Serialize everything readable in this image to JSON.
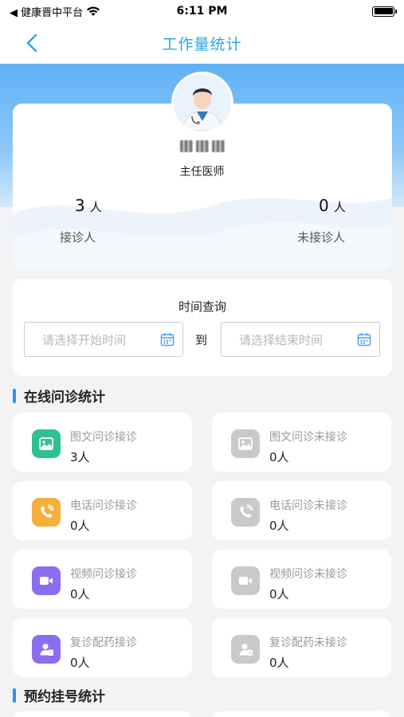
{
  "status_bar": {
    "carrier": "◀ 健康晋中平台",
    "time": "6:11 PM"
  },
  "nav": {
    "title": "工作量统计"
  },
  "profile": {
    "doctor_title": "主任医师",
    "received_count": "3",
    "received_unit": "人",
    "received_label": "接诊人",
    "not_received_count": "0",
    "not_received_unit": "人",
    "not_received_label": "未接诊人"
  },
  "query": {
    "title": "时间查询",
    "start_placeholder": "请选择开始时间",
    "end_placeholder": "请选择结束时间",
    "to_label": "到"
  },
  "sections": {
    "online": "在线问诊统计",
    "appointment": "预约挂号统计"
  },
  "tiles": [
    {
      "label": "图文问诊接诊",
      "value": "3人",
      "icon": "image-icon",
      "color": "#2ec28f"
    },
    {
      "label": "图文问诊未接诊",
      "value": "0人",
      "icon": "image-icon",
      "color": "#c9c9c9"
    },
    {
      "label": "电话问诊接诊",
      "value": "0人",
      "icon": "phone-icon",
      "color": "#f5b03b"
    },
    {
      "label": "电话问诊未接诊",
      "value": "0人",
      "icon": "phone-icon",
      "color": "#c9c9c9"
    },
    {
      "label": "视频问诊接诊",
      "value": "0人",
      "icon": "video-icon",
      "color": "#8b6ef0"
    },
    {
      "label": "视频问诊未接诊",
      "value": "0人",
      "icon": "video-icon",
      "color": "#c9c9c9"
    },
    {
      "label": "复诊配药接诊",
      "value": "0人",
      "icon": "prescription-icon",
      "color": "#8b6ef0"
    },
    {
      "label": "复诊配药未接诊",
      "value": "0人",
      "icon": "prescription-icon",
      "color": "#c9c9c9"
    }
  ],
  "colors": {
    "accent": "#2aa4e6",
    "section_bar": "#2f8ff0"
  }
}
